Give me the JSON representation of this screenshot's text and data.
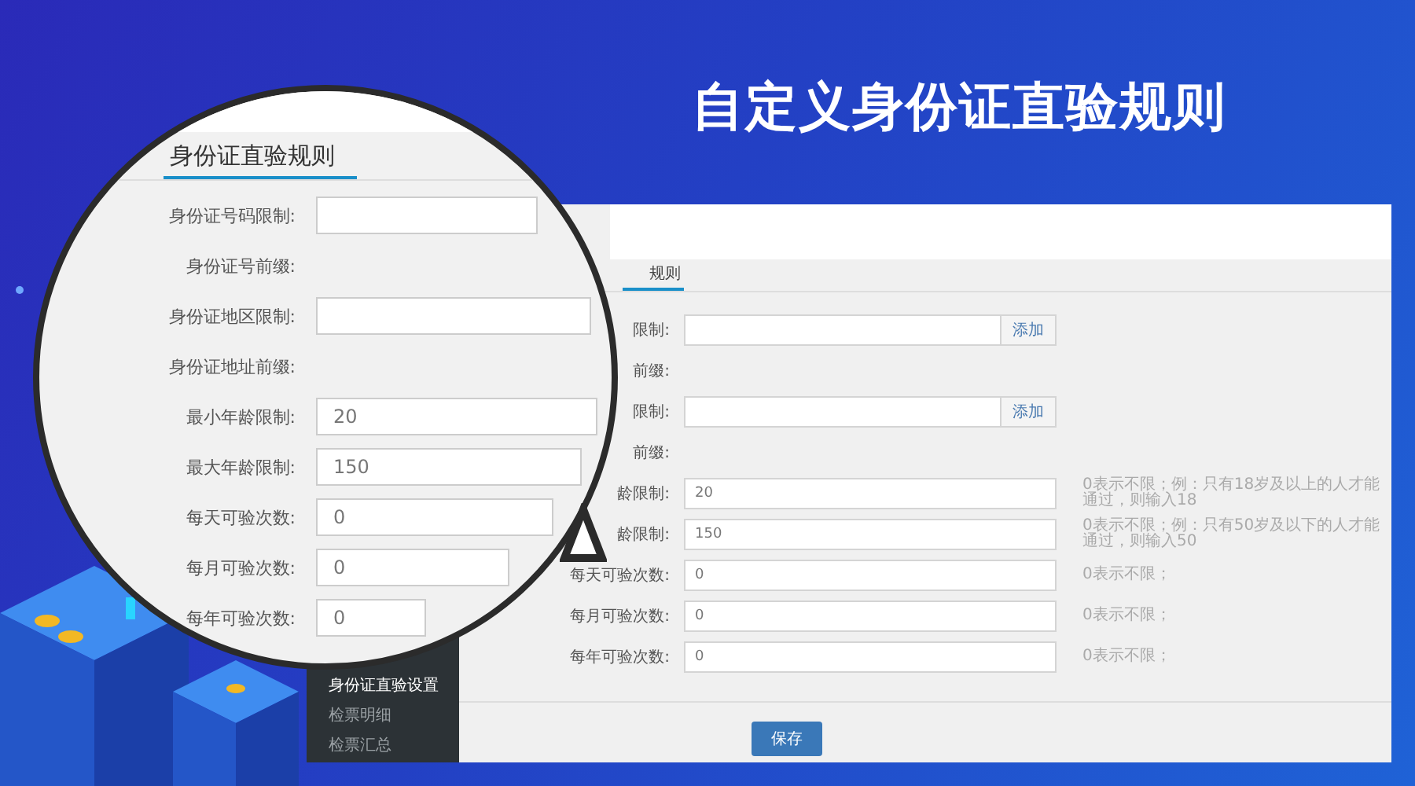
{
  "headline": "自定义身份证直验规则",
  "magnifier": {
    "tab": {
      "label": "身份证直验规则",
      "selected": true
    },
    "fields": [
      {
        "kind": "input",
        "label": "身份证号码限制:"
      },
      {
        "kind": "text",
        "label": "身份证号前缀:"
      },
      {
        "kind": "input",
        "label": "身份证地区限制:"
      },
      {
        "kind": "text",
        "label": "身份证地址前缀:"
      },
      {
        "kind": "input",
        "label": "最小年龄限制:",
        "value": "20"
      },
      {
        "kind": "input",
        "label": "最大年龄限制:",
        "value": "150"
      },
      {
        "kind": "input",
        "label": "每天可验次数:",
        "value": "0"
      },
      {
        "kind": "input",
        "label": "每月可验次数:",
        "value": "0"
      },
      {
        "kind": "input",
        "label": "每年可验次数:",
        "value": "0"
      }
    ]
  },
  "window": {
    "sidebar": {
      "items": [
        {
          "label": "身份证直验设置",
          "selected": true
        },
        {
          "label": "检票明细",
          "selected": false
        },
        {
          "label": "检票汇总",
          "selected": false
        }
      ]
    },
    "tab": {
      "label": "规则",
      "selected": true
    },
    "fields": [
      {
        "kind": "add",
        "label": "限制:",
        "button": "添加"
      },
      {
        "kind": "text",
        "label": "前缀:"
      },
      {
        "kind": "add",
        "label": "限制:",
        "button": "添加"
      },
      {
        "kind": "text",
        "label": "前缀:"
      },
      {
        "kind": "input",
        "label": "龄限制:",
        "value": "20",
        "hint": "0表示不限；例：只有18岁及以上的人才能通过，则输入18"
      },
      {
        "kind": "input",
        "label": "龄限制:",
        "value": "150",
        "hint": "0表示不限；例：只有50岁及以下的人才能通过，则输入50"
      },
      {
        "kind": "input",
        "label": "每天可验次数:",
        "value": "0",
        "hint": "0表示不限；"
      },
      {
        "kind": "input",
        "label": "每月可验次数:",
        "value": "0",
        "hint": "0表示不限；"
      },
      {
        "kind": "input",
        "label": "每年可验次数:",
        "value": "0",
        "hint": "0表示不限；"
      }
    ],
    "save_button": "保存"
  }
}
